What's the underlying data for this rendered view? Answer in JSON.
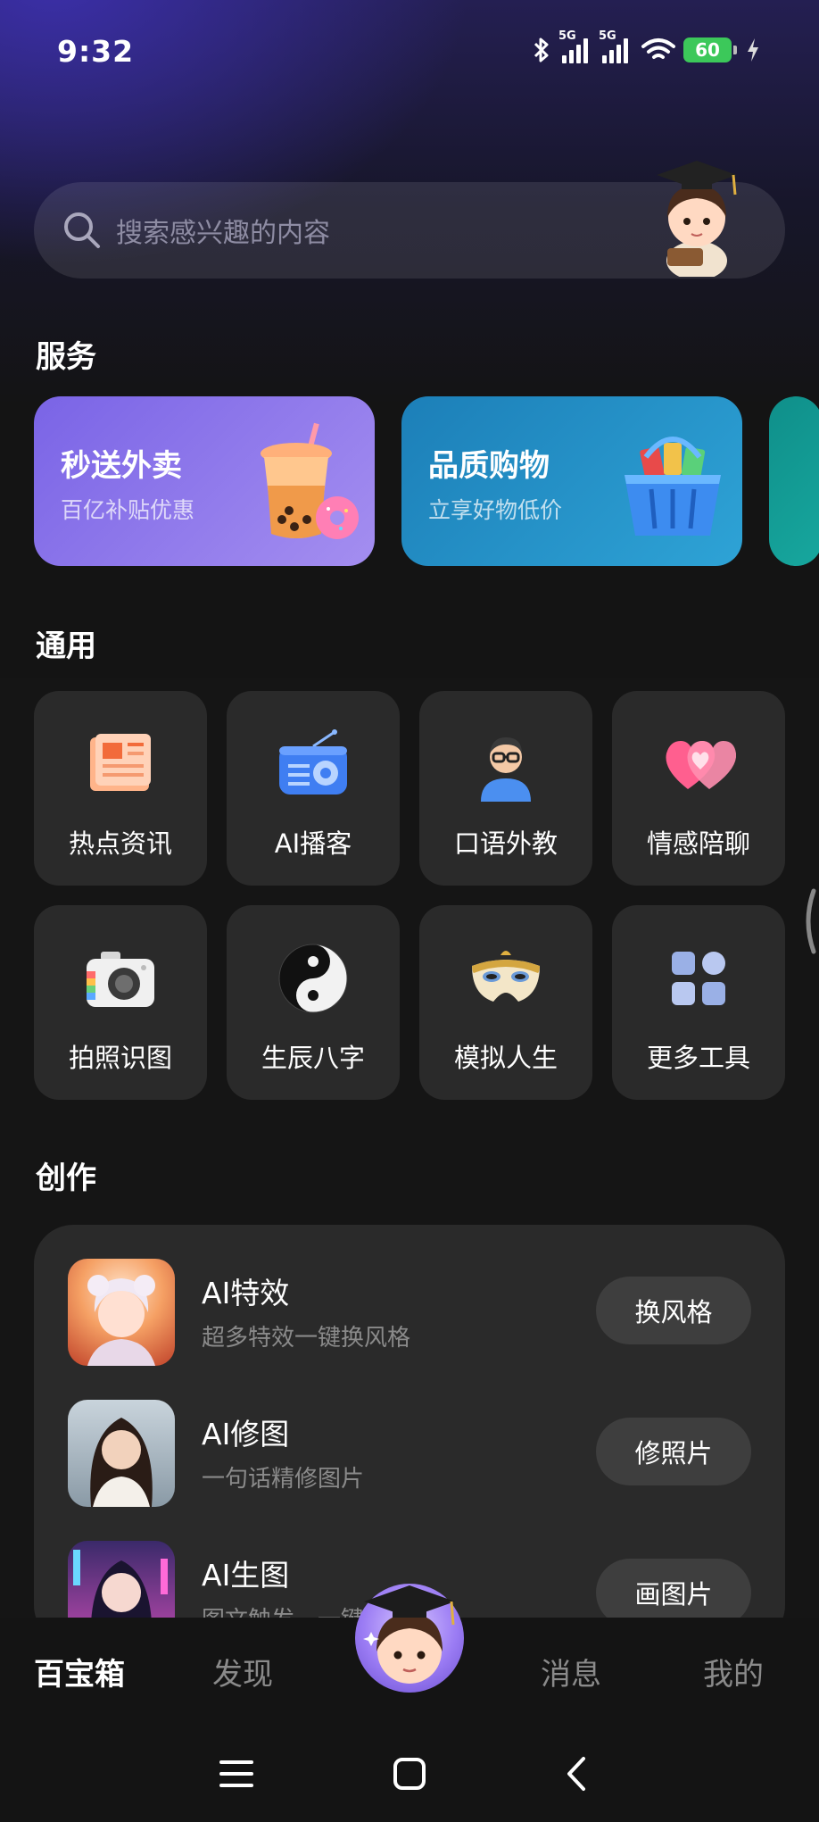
{
  "status_bar": {
    "time": "9:32",
    "network_1": "5G",
    "network_2": "5G",
    "battery": "60",
    "icons": [
      "bluetooth-icon",
      "signal-icon",
      "signal-icon",
      "wifi-icon",
      "battery-icon",
      "charging-icon"
    ]
  },
  "search": {
    "placeholder": "搜索感兴趣的内容"
  },
  "sections": {
    "services": "服务",
    "general": "通用",
    "create": "创作"
  },
  "services": [
    {
      "title": "秒送外卖",
      "subtitle": "百亿补贴优惠",
      "color_from": "#7a64e6",
      "color_to": "#a48ef0"
    },
    {
      "title": "品质购物",
      "subtitle": "立享好物低价",
      "color_from": "#1c7fb8",
      "color_to": "#2ea3d6"
    }
  ],
  "tools": [
    {
      "label": "热点资讯",
      "icon": "newspaper-icon"
    },
    {
      "label": "AI播客",
      "icon": "radio-icon"
    },
    {
      "label": "口语外教",
      "icon": "teacher-avatar-icon"
    },
    {
      "label": "情感陪聊",
      "icon": "hearts-icon"
    },
    {
      "label": "拍照识图",
      "icon": "camera-icon"
    },
    {
      "label": "生辰八字",
      "icon": "yin-yang-icon"
    },
    {
      "label": "模拟人生",
      "icon": "mask-icon"
    },
    {
      "label": "更多工具",
      "icon": "grid-icon"
    }
  ],
  "create": [
    {
      "title": "AI特效",
      "subtitle": "超多特效一键换风格",
      "button": "换风格"
    },
    {
      "title": "AI修图",
      "subtitle": "一句话精修图片",
      "button": "修照片"
    },
    {
      "title": "AI生图",
      "subtitle": "图文触发，一键创意图",
      "button": "画图片"
    }
  ],
  "bottom_nav": {
    "items": [
      "百宝箱",
      "发现",
      "消息",
      "我的"
    ],
    "active": "百宝箱"
  },
  "colors": {
    "accent": "#3b2fa8",
    "tile_bg": "#2a2a2a",
    "page_bg": "#141414"
  }
}
